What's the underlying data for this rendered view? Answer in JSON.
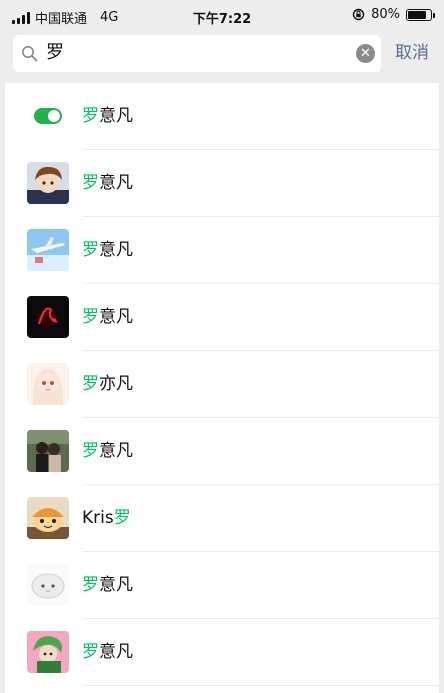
{
  "status_bar": {
    "carrier": "中国联通",
    "network": "4G",
    "time": "下午7:22",
    "battery": "80%",
    "battery_level": 0.8
  },
  "search": {
    "query": "罗",
    "cancel_label": "取消"
  },
  "results": [
    {
      "pre": "",
      "hl": "罗",
      "post": "意凡",
      "avatar": "toggle-avatar"
    },
    {
      "pre": "",
      "hl": "罗",
      "post": "意凡",
      "avatar": "anime-boy-avatar"
    },
    {
      "pre": "",
      "hl": "罗",
      "post": "意凡",
      "avatar": "airplane-avatar"
    },
    {
      "pre": "",
      "hl": "罗",
      "post": "意凡",
      "avatar": "dark-logo-avatar"
    },
    {
      "pre": "",
      "hl": "罗",
      "post": "亦凡",
      "avatar": "anime-girl-avatar"
    },
    {
      "pre": "",
      "hl": "罗",
      "post": "意凡",
      "avatar": "couple-photo-avatar"
    },
    {
      "pre": "Kris",
      "hl": "罗",
      "post": "",
      "avatar": "cartoon-avatar"
    },
    {
      "pre": "",
      "hl": "罗",
      "post": "意凡",
      "avatar": "sheep-avatar"
    },
    {
      "pre": "",
      "hl": "罗",
      "post": "意凡",
      "avatar": "green-character-avatar"
    }
  ],
  "colors": {
    "highlight": "#07c160",
    "cancel": "#576b95",
    "background": "#ededed"
  }
}
